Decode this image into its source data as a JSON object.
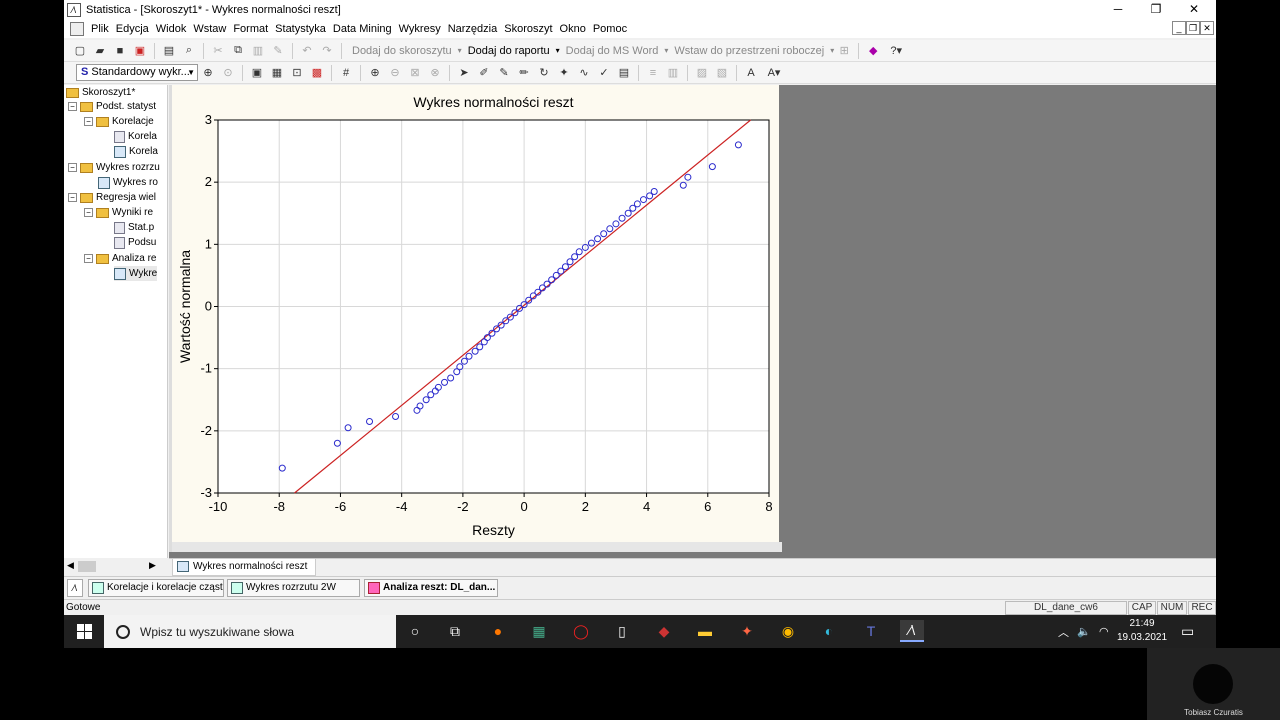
{
  "window": {
    "title": "Statistica - [Skoroszyt1* - Wykres normalności reszt]",
    "app_icon": "statistica-icon",
    "controls": [
      "─",
      "❐",
      "✕"
    ]
  },
  "menubar": {
    "items": [
      "Plik",
      "Edycja",
      "Widok",
      "Wstaw",
      "Format",
      "Statystyka",
      "Data Mining",
      "Wykresy",
      "Narzędzia",
      "Skoroszyt",
      "Okno",
      "Pomoc"
    ],
    "mdi_controls": [
      "_",
      "❐",
      "✕"
    ]
  },
  "toolbar1": {
    "add_workbook": "Dodaj do skoroszytu",
    "add_report": "Dodaj do raportu",
    "add_msword": "Dodaj do MS Word",
    "insert_workspace": "Wstaw do przestrzeni roboczej"
  },
  "toolbar2": {
    "style_select": "Standardowy wykr..."
  },
  "tree": {
    "nodes": [
      {
        "label": "Skoroszyt1*"
      },
      {
        "label": "Podst. statyst"
      },
      {
        "label": "Korelacje"
      },
      {
        "label": "Korela"
      },
      {
        "label": "Korela"
      },
      {
        "label": "Wykres rozrzu"
      },
      {
        "label": "Wykres ro"
      },
      {
        "label": "Regresja wiel"
      },
      {
        "label": "Wyniki re"
      },
      {
        "label": "Stat.p"
      },
      {
        "label": "Podsu"
      },
      {
        "label": "Analiza re"
      },
      {
        "label": "Wykre"
      }
    ]
  },
  "chart_data": {
    "type": "scatter",
    "title": "Wykres normalności reszt",
    "xlabel": "Reszty",
    "ylabel": "Wartość normalna",
    "xlim": [
      -10,
      8
    ],
    "ylim": [
      -3,
      3
    ],
    "xticks": [
      -10,
      -8,
      -6,
      -4,
      -2,
      0,
      2,
      4,
      6,
      8
    ],
    "yticks": [
      -3,
      -2,
      -1,
      0,
      1,
      2,
      3
    ],
    "grid": true,
    "reference_line": {
      "x": [
        -7.5,
        7.4
      ],
      "y": [
        -3.0,
        3.0
      ]
    },
    "points": {
      "x": [
        -7.9,
        -6.1,
        -5.75,
        -5.05,
        -4.2,
        -3.5,
        -3.4,
        -3.2,
        -3.05,
        -2.9,
        -2.8,
        -2.6,
        -2.4,
        -2.2,
        -2.1,
        -1.95,
        -1.8,
        -1.6,
        -1.45,
        -1.3,
        -1.2,
        -1.05,
        -0.9,
        -0.75,
        -0.6,
        -0.45,
        -0.3,
        -0.15,
        0.0,
        0.15,
        0.3,
        0.45,
        0.6,
        0.75,
        0.9,
        1.05,
        1.2,
        1.35,
        1.5,
        1.65,
        1.8,
        2.0,
        2.2,
        2.4,
        2.6,
        2.8,
        3.0,
        3.2,
        3.4,
        3.55,
        3.7,
        3.9,
        4.1,
        4.25,
        5.2,
        5.35,
        6.15,
        7.0
      ],
      "y": [
        -2.6,
        -2.2,
        -1.95,
        -1.85,
        -1.77,
        -1.67,
        -1.6,
        -1.5,
        -1.42,
        -1.36,
        -1.3,
        -1.22,
        -1.15,
        -1.05,
        -0.97,
        -0.88,
        -0.8,
        -0.72,
        -0.65,
        -0.57,
        -0.5,
        -0.43,
        -0.36,
        -0.3,
        -0.23,
        -0.17,
        -0.1,
        -0.03,
        0.03,
        0.1,
        0.17,
        0.23,
        0.3,
        0.36,
        0.43,
        0.5,
        0.57,
        0.64,
        0.72,
        0.8,
        0.88,
        0.95,
        1.02,
        1.09,
        1.17,
        1.25,
        1.33,
        1.42,
        1.5,
        1.58,
        1.65,
        1.72,
        1.78,
        1.85,
        1.95,
        2.08,
        2.25,
        2.6
      ]
    }
  },
  "doctabs": {
    "active": "Wykres normalności reszt"
  },
  "taskstrip": {
    "items": [
      "Korelacje i korelacje cząst...",
      "Wykres rozrzutu 2W",
      "Analiza reszt: DL_dan..."
    ]
  },
  "statusbar": {
    "ready": "Gotowe",
    "file": "DL_dane_cw6",
    "cap": "CAP",
    "num": "NUM",
    "rec": "REC"
  },
  "taskbar": {
    "search_placeholder": "Wpisz tu wyszukiwane słowa",
    "time": "21:49",
    "date": "19.03.2021"
  },
  "webcam": {
    "name": "Tobiasz Czuratis"
  },
  "colors": {
    "point": "#2a2acc",
    "line": "#cc2222",
    "plot_bg": "#ffffff",
    "chart_bg": "#fdfaf0"
  }
}
